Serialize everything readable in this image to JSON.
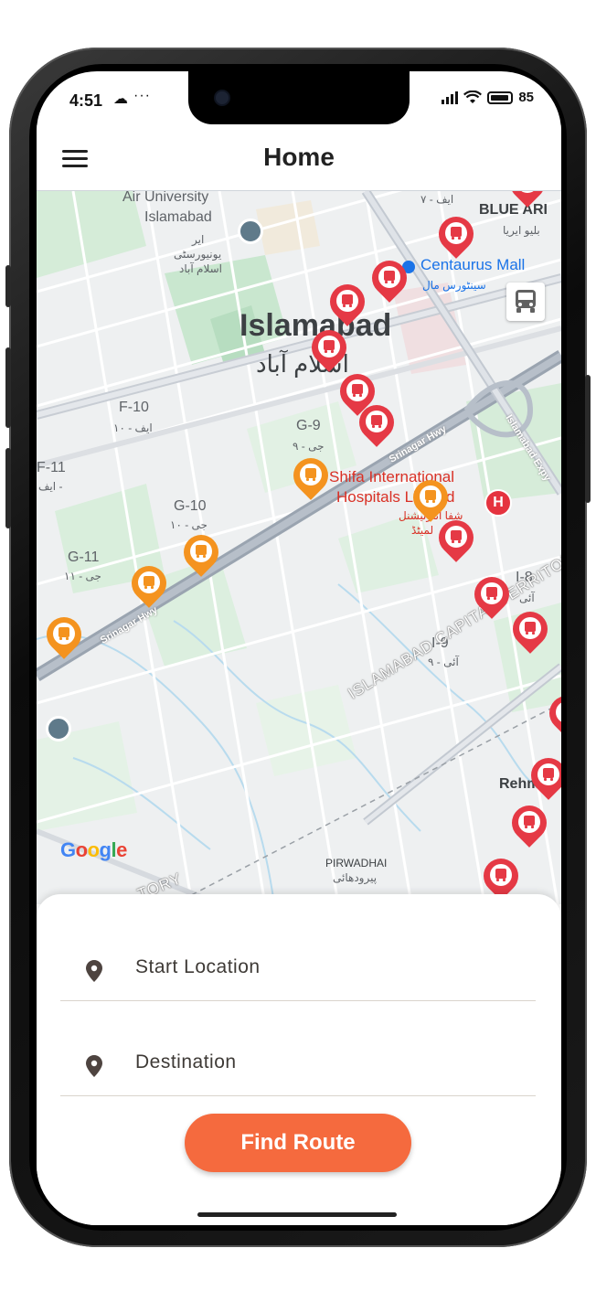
{
  "status_bar": {
    "time": "4:51",
    "more": "···",
    "battery": "85"
  },
  "app_bar": {
    "title": "Home"
  },
  "map": {
    "labels": {
      "air_university_1": "Air University",
      "air_university_2": "Islamabad",
      "air_university_ur1": "ایر",
      "air_university_ur2": "یونیورسٹی",
      "air_university_ur3": "اسلام آباد",
      "blue_area": "BLUE ARI",
      "blue_area_ur": "بلیو ایریا",
      "f7": "ایف - ۷",
      "centaurus": "Centaurus Mall",
      "centaurus_ur": "سینٹورس مال",
      "islamabad": "Islamabad",
      "islamabad_ur": "اسلام آباد",
      "f10": "F-10",
      "f10_ur": "ایف - ۱۰",
      "g9": "G-9",
      "g9_ur": "جی - ۹",
      "f11": "F-11",
      "f11_ur": "ایف -",
      "g10": "G-10",
      "g10_ur": "جی - ۱۰",
      "g11": "G-11",
      "g11_ur": "جی - ۱۱",
      "shifa_1": "Shifa International",
      "shifa_2": "Hospitals Limited",
      "shifa_ur1": "شفا انٹرنیشنل",
      "shifa_ur2": "لمیٹڈ",
      "i8": "I-8",
      "i8_ur": "آئی",
      "i9": "I-9",
      "i9_ur": "آئی - ۹",
      "srinagar_hwy_1": "Srinagar Hwy",
      "srinagar_hwy_2": "Srinagar Hwy",
      "islamabad_expy": "Islamabad Expy",
      "capital_territory": "ISLAMABAD CAPITAL TERRITORY",
      "territory_left": "TORY",
      "rehmanabad": "Rehm",
      "pirwadhai": "PIRWADHAI",
      "pirwadhai_ur": "پیرودھائی",
      "hospital_marker": "H",
      "google": "Google"
    },
    "colors": {
      "red_pin": "#e53945",
      "orange_pin": "#f4931f"
    },
    "icons": {
      "bus_stop_marker": "bus-icon",
      "transit_layer_button": "bus-icon"
    }
  },
  "route_form": {
    "start_placeholder": "Start Location",
    "destination_placeholder": "Destination",
    "find_route_label": "Find Route"
  },
  "colors": {
    "accent": "#f56a3e",
    "text": "#3e3a36"
  }
}
